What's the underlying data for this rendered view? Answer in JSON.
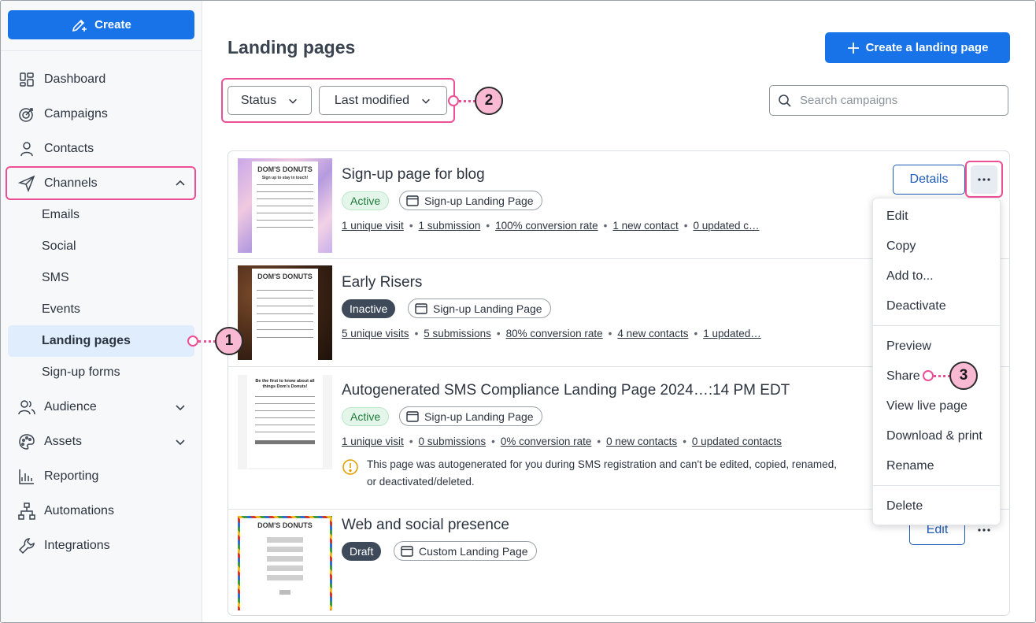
{
  "sidebar": {
    "create_label": "Create",
    "nav": [
      {
        "label": "Dashboard",
        "icon": "dashboard-icon"
      },
      {
        "label": "Campaigns",
        "icon": "target-icon"
      },
      {
        "label": "Contacts",
        "icon": "person-icon"
      },
      {
        "label": "Channels",
        "icon": "paper-plane-icon",
        "expanded": true
      },
      {
        "label": "Audience",
        "icon": "people-icon"
      },
      {
        "label": "Assets",
        "icon": "palette-icon"
      },
      {
        "label": "Reporting",
        "icon": "chart-icon"
      },
      {
        "label": "Automations",
        "icon": "flowchart-icon"
      },
      {
        "label": "Integrations",
        "icon": "wrench-icon"
      }
    ],
    "channels_sub": [
      "Emails",
      "Social",
      "SMS",
      "Events",
      "Landing pages",
      "Sign-up forms"
    ],
    "active_sub": "Landing pages"
  },
  "header": {
    "title": "Landing pages",
    "create_button": "Create a landing page"
  },
  "filters": {
    "status": "Status",
    "sort": "Last modified",
    "search_placeholder": "Search campaigns"
  },
  "callouts": [
    "1",
    "2",
    "3"
  ],
  "rows": [
    {
      "title": "Sign-up page for blog",
      "status": "Active",
      "type": "Sign-up Landing Page",
      "stats": [
        "1 unique visit",
        "1 submission",
        "100% conversion rate",
        "1 new contact",
        "0 updated c…"
      ],
      "action": "Details"
    },
    {
      "title": "Early Risers",
      "status": "Inactive",
      "type": "Sign-up Landing Page",
      "stats": [
        "5 unique visits",
        "5 submissions",
        "80% conversion rate",
        "4 new contacts",
        "1 updated…"
      ]
    },
    {
      "title": "Autogenerated SMS Compliance Landing Page 2024…:14 PM EDT",
      "status": "Active",
      "type": "Sign-up Landing Page",
      "stats": [
        "1 unique visit",
        "0 submissions",
        "0% conversion rate",
        "0 new contacts",
        "0 updated contacts"
      ],
      "notice": "This page was autogenerated for you during SMS registration and can't be edited, copied, renamed, or deactivated/deleted."
    },
    {
      "title": "Web and social presence",
      "status": "Draft",
      "type": "Custom Landing Page",
      "action": "Edit"
    }
  ],
  "menu": {
    "group1": [
      "Edit",
      "Copy",
      "Add to...",
      "Deactivate"
    ],
    "group2": [
      "Preview",
      "Share",
      "View live page",
      "Download & print",
      "Rename"
    ],
    "group3": [
      "Delete"
    ]
  },
  "thumbnails": {
    "brand": "DOM'S DONUTS",
    "t1_heading": "Sign up to stay in touch!",
    "t3_heading": "Be the first to know about all things Dom's Donuts!"
  },
  "colors": {
    "primary": "#1973e8",
    "highlight": "#ec4f95",
    "callout_fill": "#f9b9d3",
    "active_nav": "#e0edfc"
  }
}
